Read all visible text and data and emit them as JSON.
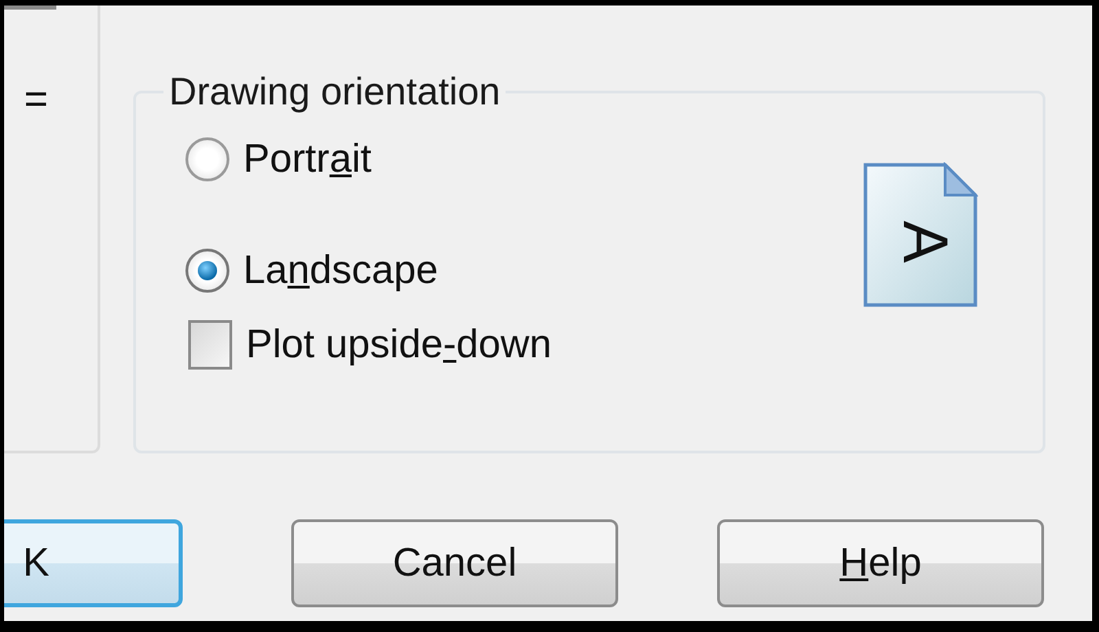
{
  "left_panel": {
    "clipped_text": "="
  },
  "orientation_group": {
    "title": "Drawing orientation",
    "options": [
      {
        "kind": "radio",
        "label": {
          "before": "Portr",
          "access_key": "a",
          "after": "it"
        },
        "selected": false
      },
      {
        "kind": "radio",
        "label": {
          "before": "La",
          "access_key": "n",
          "after": "dscape"
        },
        "selected": true
      },
      {
        "kind": "checkbox",
        "label": {
          "before": "Plot upside",
          "access_key": "-",
          "after": "down"
        },
        "checked": false
      }
    ],
    "preview_icon": {
      "letter": "A"
    }
  },
  "buttons": [
    {
      "label": {
        "before": "K"
      },
      "default": true
    },
    {
      "label": {
        "before": "Cancel"
      },
      "default": false
    },
    {
      "label": {
        "access_key": "H",
        "after": "elp"
      },
      "default": false
    }
  ]
}
